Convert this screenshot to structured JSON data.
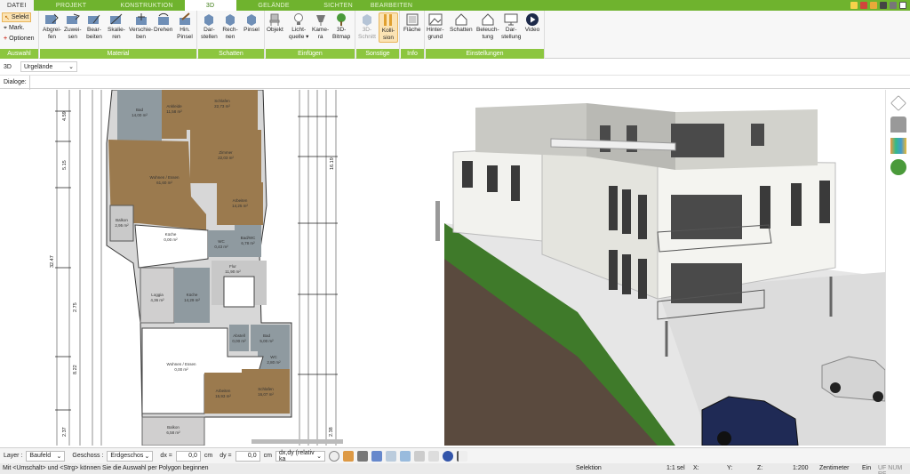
{
  "tabs": {
    "datei": "DATEI",
    "projekt": "PROJEKT",
    "konstruktion": "KONSTRUKTION",
    "d3": "3D",
    "gelaende": "GELÄNDE",
    "sichten": "SICHTEN",
    "bearbeiten": "BEARBEITEN"
  },
  "ribbon": {
    "auswahl": {
      "label": "Auswahl",
      "selekt": "Selekt",
      "mark": "Mark.",
      "optionen": "Optionen"
    },
    "material": {
      "label": "Material",
      "abgreifen": "Abgrei-\nfen",
      "zuweisen": "Zuwei-\nsen",
      "bearbeiten": "Bear-\nbeiten",
      "skalieren": "Skalie-\nren",
      "verschieben": "Verschie-\nben",
      "drehen": "Drehen",
      "pinsel": "Hin.\nPinsel"
    },
    "schatten": {
      "label": "Schatten",
      "darstellen": "Dar-\nstellen",
      "rechnen": "Rech-\nnen",
      "pinsel": "Pinsel"
    },
    "einfuegen": {
      "label": "Einfügen",
      "objekt": "Objekt",
      "lichtquelle": "Licht-\nquelle ▾",
      "kamera": "Kame-\nra",
      "bitmap": "3D-\nBitmap"
    },
    "sonstige": {
      "label": "Sonstige",
      "schnitt": "3D-\nSchnitt",
      "kollision": "Kolli-\nsion"
    },
    "info": {
      "label": "Info",
      "flaeche": "Fläche"
    },
    "einstellungen": {
      "label": "Einstellungen",
      "hintergrund": "Hinter-\ngrund",
      "schatten": "Schatten",
      "beleuchtung": "Beleuch-\ntung",
      "darstellung": "Dar-\nstellung",
      "video": "Video"
    }
  },
  "viewbar": {
    "mode": "3D",
    "terrain": "Urgelände"
  },
  "dialoge": "Dialoge:",
  "plan": {
    "rooms": [
      {
        "name": "Bad",
        "area": "14,00 m²"
      },
      {
        "name": "Ankleide",
        "area": "11,58 m²"
      },
      {
        "name": "Schlafen",
        "area": "22,73 m²"
      },
      {
        "name": "Zimmer",
        "area": "22,03 m²"
      },
      {
        "name": "Wohnen / Essen",
        "area": "61,60 m²"
      },
      {
        "name": "Arbeiten",
        "area": "14,25 m²"
      },
      {
        "name": "Balkon",
        "area": "2,95 m²"
      },
      {
        "name": "Küche",
        "area": "0,00 m²"
      },
      {
        "name": "WC",
        "area": "0,43 m²"
      },
      {
        "name": "Bad/WC",
        "area": "6,78 m²"
      },
      {
        "name": "Flur",
        "area": "11,90 m²"
      },
      {
        "name": "Loggia",
        "area": "4,36 m²"
      },
      {
        "name": "Küche",
        "area": "14,29 m²"
      },
      {
        "name": "Abstell",
        "area": "0,00 m²"
      },
      {
        "name": "Bad",
        "area": "5,00 m²"
      },
      {
        "name": "WC",
        "area": "2,80 m²"
      },
      {
        "name": "Wohnen / Essen",
        "area": "0,00 m²"
      },
      {
        "name": "Arbeiten",
        "area": "15,93 m²"
      },
      {
        "name": "Schlafen",
        "area": "16,07 m²"
      },
      {
        "name": "Balkon",
        "area": "6,58 m²"
      }
    ],
    "dims_left": [
      "4.59",
      "5.15",
      "32.47",
      "2.75",
      "8.22",
      "2.37"
    ],
    "dims_right": [
      "16.19",
      "2.38"
    ]
  },
  "bottom": {
    "layer_label": "Layer :",
    "layer_value": "Baufeld",
    "geschoss_label": "Geschoss :",
    "geschoss_value": "Erdgeschos",
    "dx_label": "dx =",
    "dx_value": "0,0",
    "dy_label": "dy =",
    "dy_value": "0,0",
    "unit": "cm",
    "mode": "dx,dy (relativ ka"
  },
  "status": {
    "hint": "Mit <Umschalt> und <Strg> können Sie die Auswahl per Polygon beginnen",
    "selektion": "Selektion",
    "sel": "1:1 sel",
    "x": "X:",
    "y": "Y:",
    "z": "Z:",
    "scale": "1:200",
    "unit": "Zentimeter",
    "ein": "Ein",
    "flags": "UF NUM RF"
  },
  "colors": {
    "green": "#6fb32e",
    "green_light": "#8cc63f",
    "wood": "#9b7a4e",
    "tile": "#8a9499",
    "active": "#fbe3b4"
  }
}
